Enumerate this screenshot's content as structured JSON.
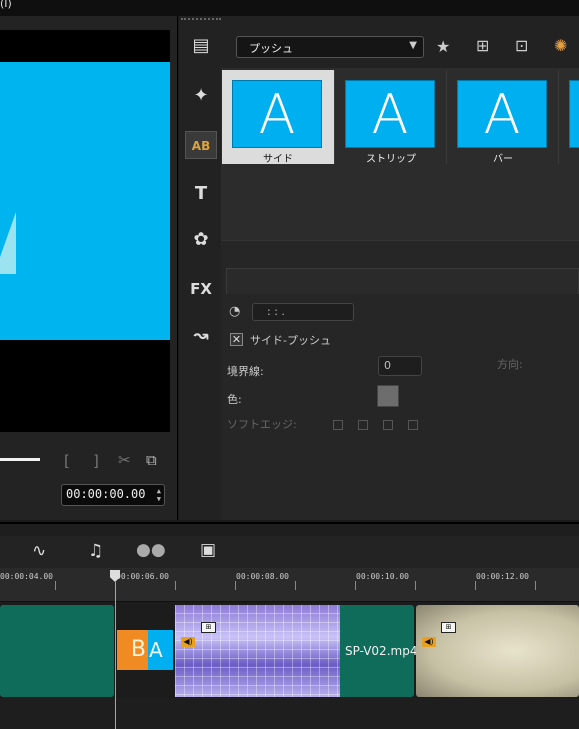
{
  "menubar": {
    "label": "(I)"
  },
  "preview": {
    "letter": "A",
    "controls": {
      "mark_in": "[",
      "mark_out": "]",
      "cut_icon": "✂",
      "copy_icon": "⧉"
    },
    "timecode": "00:00:00.00",
    "spin_up": "▲",
    "spin_down": "▼"
  },
  "library": {
    "category": "プッシュ",
    "caret": "▼",
    "side_icons": [
      {
        "name": "media-icon",
        "glyph": "▤"
      },
      {
        "name": "instant-project-icon",
        "glyph": "✦"
      },
      {
        "name": "transition-icon",
        "glyph": "AB"
      },
      {
        "name": "title-icon",
        "glyph": "T"
      },
      {
        "name": "graphic-icon",
        "glyph": "✿"
      },
      {
        "name": "filter-icon",
        "glyph": "FX"
      },
      {
        "name": "path-icon",
        "glyph": "↝"
      }
    ],
    "tools": [
      {
        "name": "add-favorite-icon",
        "glyph": "★"
      },
      {
        "name": "apply-transition-icon",
        "glyph": "⊞"
      },
      {
        "name": "apply-random-icon",
        "glyph": "⊡"
      },
      {
        "name": "options-wheel-icon",
        "glyph": "✺"
      }
    ],
    "thumbnails": [
      {
        "letter": "A",
        "caption": "サイド",
        "selected": true
      },
      {
        "letter": "A",
        "caption": "ストリップ",
        "selected": false
      },
      {
        "letter": "A",
        "caption": "バー",
        "selected": false
      }
    ],
    "options": {
      "duration": ":  :  .",
      "checkbox_label": "サイド-プッシュ",
      "check_mark": "✕",
      "border_label": "境界線:",
      "border_value": "0",
      "color_label": "色:",
      "soft_edge_label": "ソフトエッジ:",
      "direction_label": "方向:"
    }
  },
  "timeline": {
    "tools": [
      {
        "name": "audio-wave-icon",
        "glyph": "∿"
      },
      {
        "name": "sound-mixer-icon",
        "glyph": "♫"
      },
      {
        "name": "track-manager-icon",
        "glyph": "●●"
      },
      {
        "name": "chapter-icon",
        "glyph": "▣"
      }
    ],
    "ruler": [
      "00:00:04.00",
      "00:00:06.00",
      "00:00:08.00",
      "00:00:10.00",
      "00:00:12.00"
    ],
    "clip_name": "SP-V02.mp4",
    "transition_letters": [
      "B",
      "A"
    ],
    "speaker": "◀)",
    "fx": "⊞"
  },
  "colors": {
    "accent_blue": "#00b4f0",
    "clip_green": "#0f6b5a",
    "playhead": "#5ab8ff"
  }
}
